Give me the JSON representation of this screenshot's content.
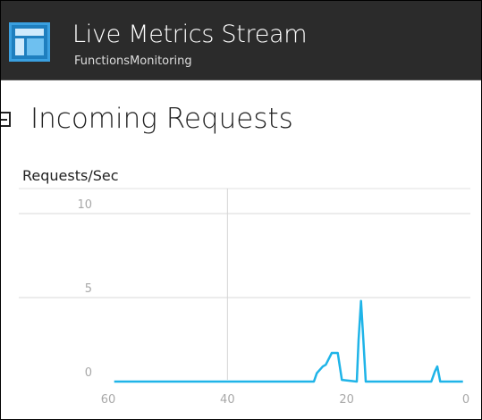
{
  "header": {
    "title": "Live Metrics Stream",
    "subtitle": "FunctionsMonitoring",
    "icon": "dashboard-layout-icon"
  },
  "section": {
    "title": "Incoming Requests",
    "collapse_icon": "collapse-minus-icon"
  },
  "chart_data": {
    "type": "line",
    "ylabel": "Requests/Sec",
    "x_ticks": [
      "60",
      "40",
      "20",
      "0"
    ],
    "y_ticks": [
      "10",
      "5",
      "0"
    ],
    "xlim": [
      60,
      0
    ],
    "ylim": [
      0,
      10
    ],
    "grid": true,
    "series": [
      {
        "color": "#1fb4e8",
        "x": [
          59,
          25.5,
          25,
          24,
          23.5,
          22.5,
          21.5,
          20.8,
          18.3,
          18,
          17.6,
          17.2,
          16.8,
          15.5,
          5.8,
          5.2,
          4.8,
          4.3,
          0.5
        ],
        "y": [
          0,
          0,
          0.5,
          0.9,
          1.0,
          1.7,
          1.7,
          0.1,
          0,
          2.5,
          4.8,
          2.5,
          0,
          0,
          0,
          0.6,
          0.9,
          0,
          0
        ]
      }
    ]
  }
}
